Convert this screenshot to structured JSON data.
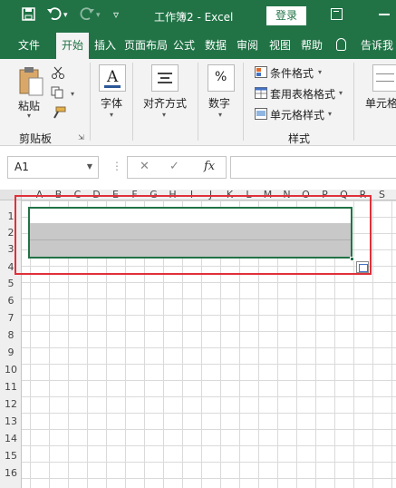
{
  "titlebar": {
    "save_icon": "save-icon",
    "undo_icon": "undo-icon",
    "redo_icon": "redo-icon",
    "qa_dropdown": "▿",
    "title": "工作簿2  -  Excel",
    "login": "登录"
  },
  "tabs": [
    "文件",
    "开始",
    "插入",
    "页面布局",
    "公式",
    "数据",
    "审阅",
    "视图",
    "帮助",
    "告诉我"
  ],
  "active_tab": "开始",
  "ribbon": {
    "paste": "粘贴",
    "clipboard": "剪贴板",
    "font": "字体",
    "align": "对齐方式",
    "number": "数字",
    "conditional": "条件格式",
    "table_format": "套用表格格式",
    "cell_style": "单元格样式",
    "styles": "样式",
    "cells": "单元格"
  },
  "formula_bar": {
    "name_box": "A1",
    "cancel": "✕",
    "enter": "✓",
    "fx": "fx",
    "formula": ""
  },
  "columns": [
    "A",
    "B",
    "C",
    "D",
    "E",
    "F",
    "G",
    "H",
    "I",
    "J",
    "K",
    "L",
    "M",
    "N",
    "O",
    "P",
    "Q",
    "R",
    "S"
  ],
  "rows": [
    "1",
    "2",
    "3",
    "4",
    "5",
    "6",
    "7",
    "8",
    "9",
    "10",
    "11",
    "12",
    "13",
    "14",
    "15",
    "16"
  ],
  "selected_range": "A1:Q3",
  "colors": {
    "accent": "#217346",
    "highlight_box": "#e0303a",
    "selection_fill": "#c8c8c8"
  }
}
